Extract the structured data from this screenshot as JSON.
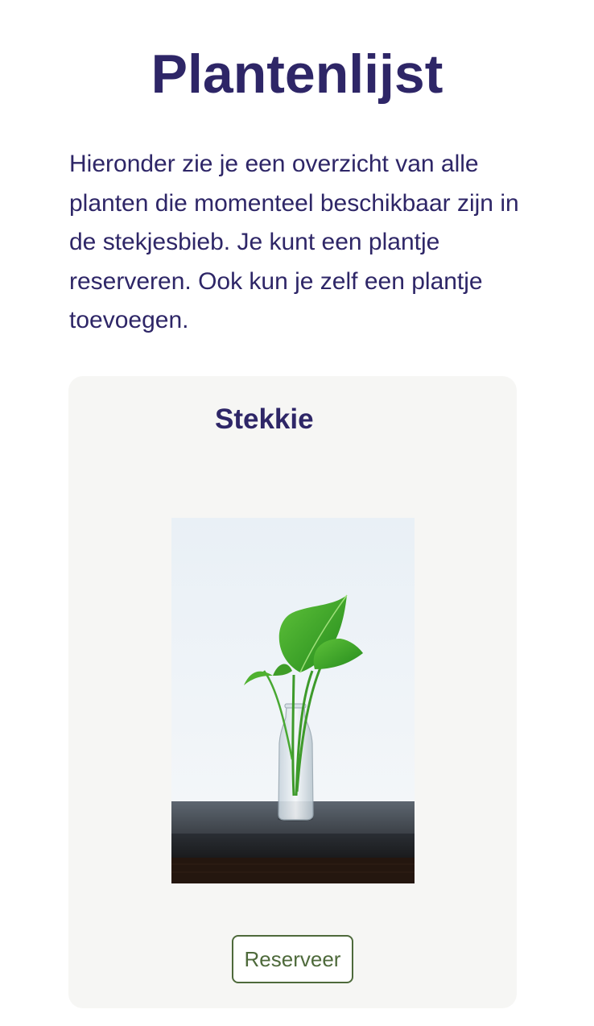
{
  "page": {
    "title": "Plantenlijst",
    "intro": "Hieronder zie je een overzicht van alle planten die momenteel beschikbaar zijn in de stekjesbieb. Je kunt een plantje reserveren. Ook kun je zelf een plantje toevoegen."
  },
  "plants": [
    {
      "name": "Stekkie",
      "reserve_label": "Reserveer"
    }
  ],
  "colors": {
    "heading": "#2e2667",
    "card_background": "#f6f6f4",
    "button_accent": "#4e6a3b"
  }
}
